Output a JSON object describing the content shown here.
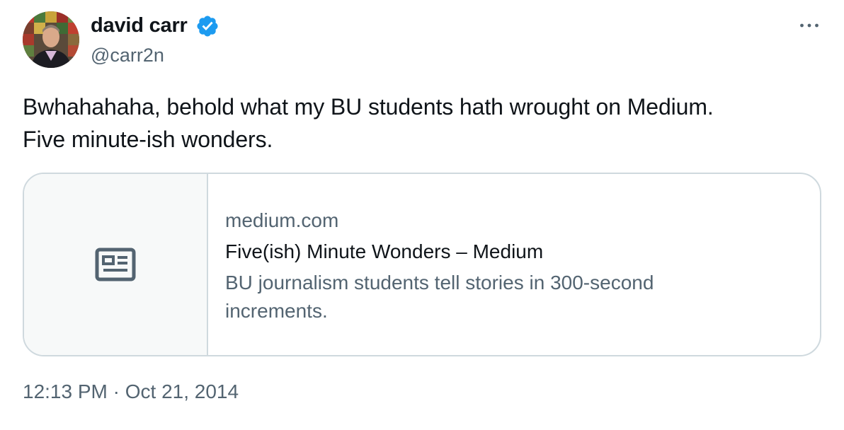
{
  "author": {
    "name": "david carr",
    "handle": "@carr2n",
    "verified": true,
    "avatar_icon": "avatar-photo"
  },
  "menu": {
    "icon": "more-horizontal-icon"
  },
  "tweet": {
    "text_lines": [
      "Bwhahahaha, behold what my BU students hath wrought on Medium.",
      "Five minute-ish wonders."
    ]
  },
  "card": {
    "icon": "article-icon",
    "domain": "medium.com",
    "title": "Five(ish) Minute Wonders – Medium",
    "description": "BU journalism students tell stories in 300-second increments."
  },
  "timestamp": "12:13 PM · Oct 21, 2014",
  "colors": {
    "text_primary": "#0f1419",
    "text_secondary": "#536471",
    "border": "#cfd9de",
    "verified_blue": "#1d9bf0",
    "card_thumb_bg": "#f7f9f9"
  }
}
